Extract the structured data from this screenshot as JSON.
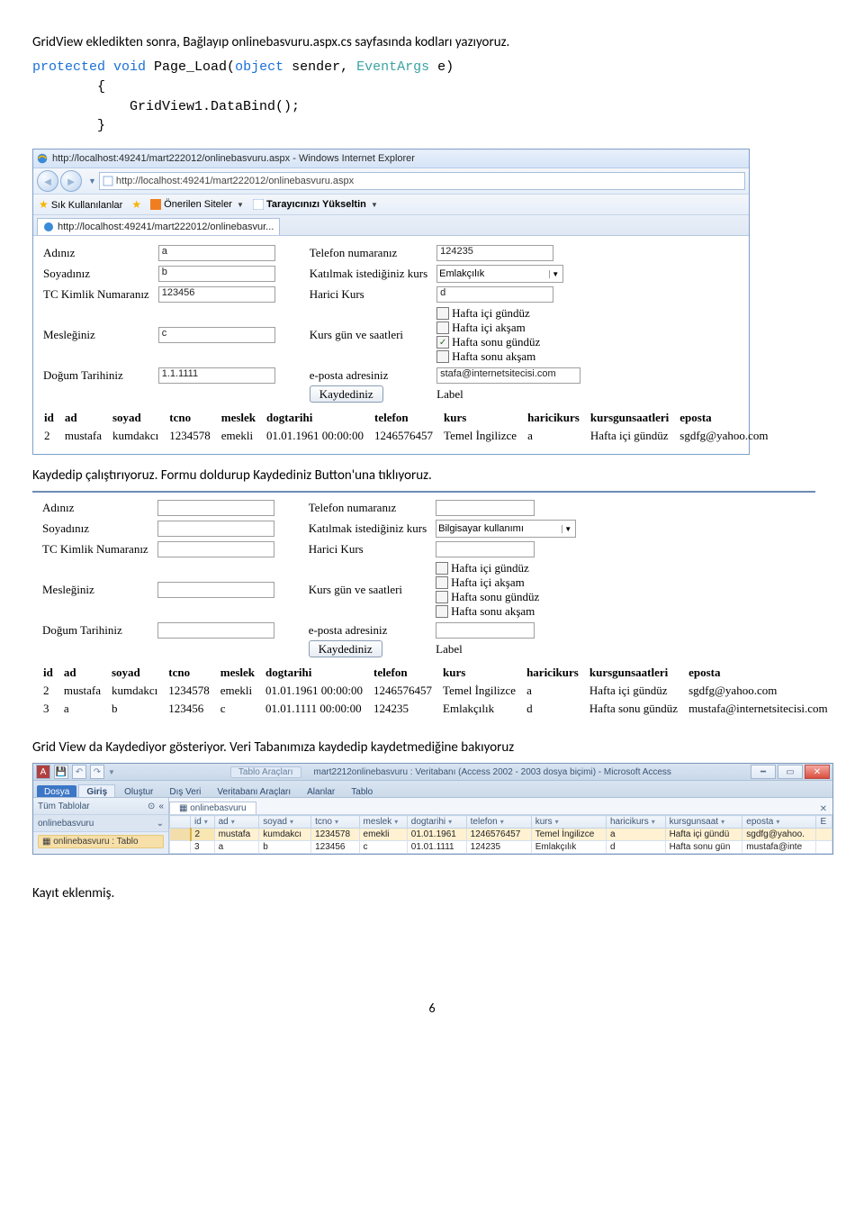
{
  "para1": "GridView ekledikten sonra, Bağlayıp  onlinebasvuru.aspx.cs sayfasında kodları yazıyoruz.",
  "code": {
    "l1a": "protected",
    "l1b": "void",
    "l1c": " Page_Load(",
    "l1d": "object",
    "l1e": " sender, ",
    "l1f": "EventArgs",
    "l1g": " e)",
    "l2": "        {",
    "l3": "            GridView1.DataBind();",
    "l4": "        }"
  },
  "ie": {
    "title": "http://localhost:49241/mart222012/onlinebasvuru.aspx - Windows Internet Explorer",
    "url": "http://localhost:49241/mart222012/onlinebasvuru.aspx",
    "fav1": "Sık Kullanılanlar",
    "fav2": "Önerilen Siteler ",
    "fav3": "Tarayıcınızı Yükseltin ",
    "tab": "http://localhost:49241/mart222012/onlinebasvur..."
  },
  "form1": {
    "adiniz": "Adınız",
    "adiniz_v": "a",
    "soyadiniz": "Soyadınız",
    "soyadiniz_v": "b",
    "tc": "TC Kimlik Numaranız",
    "tc_v": "123456",
    "meslek": "Mesleğiniz",
    "meslek_v": "c",
    "dogum": "Doğum Tarihiniz",
    "dogum_v": "1.1.1111",
    "tel": "Telefon numaranız",
    "tel_v": "124235",
    "kurs": "Katılmak istediğiniz kurs",
    "kurs_v": "Emlakçılık",
    "harici": "Harici Kurs",
    "harici_v": "d",
    "saat": "Kurs gün ve saatleri",
    "s1": "Hafta içi gündüz",
    "s2": "Hafta içi akşam",
    "s3": "Hafta sonu gündüz",
    "s4": "Hafta sonu akşam",
    "eposta": "e-posta adresiniz",
    "eposta_v": "stafa@internetsitecisi.com",
    "kaydet": "Kaydediniz",
    "label": "Label"
  },
  "grid1": {
    "headers": [
      "id",
      "ad",
      "soyad",
      "tcno",
      "meslek",
      "dogtarihi",
      "telefon",
      "kurs",
      "haricikurs",
      "kursgunsaatleri",
      "eposta"
    ],
    "rows": [
      [
        "2",
        "mustafa",
        "kumdakcı",
        "1234578",
        "emekli",
        "01.01.1961 00:00:00",
        "1246576457",
        "Temel İngilizce",
        "a",
        "Hafta içi gündüz",
        "sgdfg@yahoo.com"
      ]
    ]
  },
  "para2": "Kaydedip çalıştırıyoruz. Formu doldurup Kaydediniz Button'una tıklıyoruz.",
  "form2": {
    "kurs_v": "Bilgisayar kullanımı"
  },
  "grid2": {
    "rows": [
      [
        "2",
        "mustafa",
        "kumdakcı",
        "1234578",
        "emekli",
        "01.01.1961 00:00:00",
        "1246576457",
        "Temel İngilizce",
        "a",
        "Hafta içi gündüz",
        "sgdfg@yahoo.com"
      ],
      [
        "3",
        "a",
        "b",
        "123456",
        "c",
        "01.01.1111 00:00:00",
        "124235",
        "Emlakçılık",
        "d",
        "Hafta sonu gündüz",
        "mustafa@internetsitecisi.com"
      ]
    ]
  },
  "para3": "Grid View da Kaydediyor gösteriyor. Veri Tabanımıza kaydedip kaydetmediğine bakıyoruz",
  "access": {
    "contextTab": "Tablo Araçları",
    "title": "mart2212onlinebasvuru : Veritabanı (Access 2002 - 2003 dosya biçimi)  -  Microsoft Access",
    "tabs": {
      "file": "Dosya",
      "t1": "Giriş",
      "t2": "Oluştur",
      "t3": "Dış Veri",
      "t4": "Veritabanı Araçları",
      "t5": "Alanlar",
      "t6": "Tablo"
    },
    "nav": {
      "head": "Tüm Tablolar",
      "grp": "onlinebasvuru",
      "item": "onlinebasvuru : Tablo"
    },
    "sheetTab": "onlinebasvuru",
    "cols": [
      "id",
      "ad",
      "soyad",
      "tcno",
      "meslek",
      "dogtarihi",
      "telefon",
      "kurs",
      "haricikurs",
      "kursgunsaat",
      "eposta",
      "E"
    ],
    "rows": [
      [
        "2",
        "mustafa",
        "kumdakcı",
        "1234578",
        "emekli",
        "01.01.1961",
        "1246576457",
        "Temel İngilizce",
        "a",
        "Hafta içi gündü",
        "sgdfg@yahoo."
      ],
      [
        "3",
        "a",
        "b",
        "123456",
        "c",
        "01.01.1111",
        "124235",
        "Emlakçılık",
        "d",
        "Hafta sonu gün",
        "mustafa@inte"
      ]
    ]
  },
  "para4": "Kayıt eklenmiş.",
  "pageNum": "6"
}
